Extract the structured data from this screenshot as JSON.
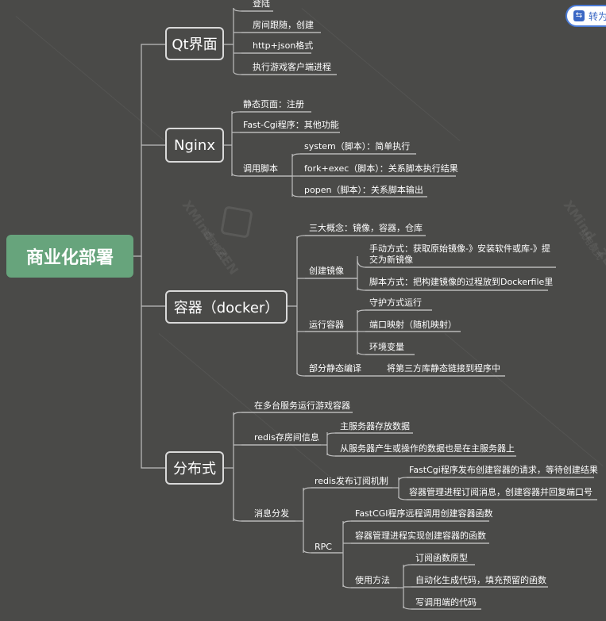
{
  "root": "商业化部署",
  "branches": {
    "qt": {
      "title": "Qt界面",
      "items": [
        "登陆",
        "房间跟随，创建",
        "http+json格式",
        "执行游戏客户端进程"
      ]
    },
    "nginx": {
      "title": "Nginx",
      "items": [
        "静态页面：注册",
        "Fast-Cgi程序：其他功能"
      ],
      "script": {
        "label": "调用脚本",
        "items": [
          "system（脚本）：简单执行",
          "fork+exec（脚本）：关系脚本执行结果",
          "popen（脚本）：关系脚本输出"
        ]
      }
    },
    "docker": {
      "title": "容器（docker）",
      "concepts": "三大概念：镜像，容器，仓库",
      "create": {
        "label": "创建镜像",
        "items": [
          "手动方式：获取原始镜像-》安装软件或库-》提交为新镜像",
          "脚本方式：把构建镜像的过程放到Dockerfile里"
        ]
      },
      "run": {
        "label": "运行容器",
        "items": [
          "守护方式运行",
          "端口映射（随机映射）",
          "环境变量"
        ]
      },
      "static": {
        "label": "部分静态编译",
        "item": "将第三方库静态链接到程序中"
      }
    },
    "dist": {
      "title": "分布式",
      "multi": "在多台服务运行游戏容器",
      "redis": {
        "label": "redis存房间信息",
        "items": [
          "主服务器存放数据",
          "从服务器产生或操作的数据也是在主服务器上"
        ]
      },
      "msg": {
        "label": "消息分发",
        "pubsub": {
          "label": "redis发布订阅机制",
          "items": [
            "FastCgi程序发布创建容器的请求，等待创建结果",
            "容器管理进程订阅消息，创建容器并回复端口号"
          ]
        },
        "rpc": {
          "label": "RPC",
          "items": [
            "FastCGI程序远程调用创建容器函数",
            "容器管理进程实现创建容器的函数"
          ],
          "usage": {
            "label": "使用方法",
            "items": [
              "订阅函数原型",
              "自动化生成代码，填充预留的函数",
              "写调用端的代码"
            ]
          }
        }
      }
    }
  },
  "toolbar": {
    "convert_label": "转为"
  },
  "watermark": {
    "brand": "XMind · ZEN",
    "sub": "试用模式"
  },
  "colors": {
    "background": "#4a4a48",
    "root": "#67a47c",
    "line": "#bdbdbd",
    "button_border": "#4b7bd6"
  }
}
